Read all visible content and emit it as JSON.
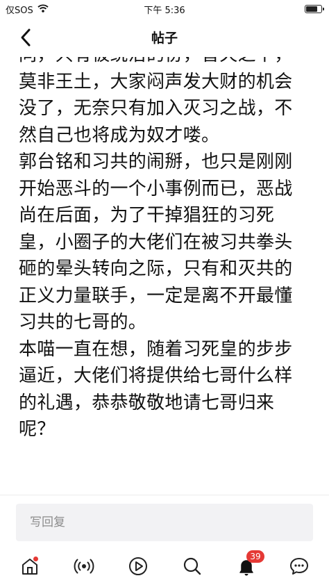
{
  "status_bar": {
    "carrier": "仅SOS",
    "time": "下午 5:36"
  },
  "nav": {
    "title": "帖子"
  },
  "post": {
    "paragraphs": [
      "同，只有被统治的份，普天之下，莫非王土，大家闷声发大财的机会没了，无奈只有加入灭习之战，不然自己也将成为奴才喽。",
      "郭台铭和习共的闹掰，也只是刚刚开始恶斗的一个小事例而已，恶战尚在后面，为了干掉猖狂的习死皇，小圈子的大佬们在被习共拳头砸的晕头转向之际，只有和灭共的正义力量联手，一定是离不开最懂习共的七哥的。",
      "本喵一直在想，随着习死皇的步步逼近，大佬们将提供给七哥什么样的礼遇，恭恭敬敬地请七哥归来呢？"
    ]
  },
  "reply": {
    "placeholder": "写回复"
  },
  "tab_bar": {
    "items": [
      "home-icon",
      "broadcast-icon",
      "play-icon",
      "search-icon",
      "bell-icon",
      "chat-icon"
    ],
    "notification_count": "39"
  },
  "colors": {
    "accent": "#e53935",
    "icon": "#222222",
    "input_bg": "#f2f2f4",
    "placeholder": "#8c8c8c"
  }
}
